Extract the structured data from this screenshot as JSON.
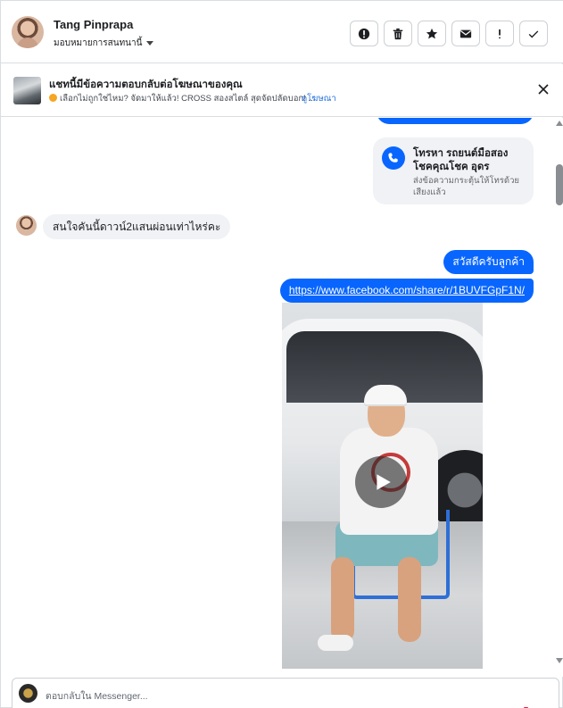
{
  "header": {
    "contact_name": "Tang Pinprapa",
    "assign_label": "มอบหมายการสนทนานี้",
    "actions": [
      {
        "name": "report-spam-button",
        "icon": "alert-circle-icon"
      },
      {
        "name": "delete-button",
        "icon": "trash-icon"
      },
      {
        "name": "star-button",
        "icon": "star-icon"
      },
      {
        "name": "mark-unread-button",
        "icon": "envelope-icon"
      },
      {
        "name": "follow-up-button",
        "icon": "exclamation-icon"
      },
      {
        "name": "mark-done-button",
        "icon": "checkmark-icon"
      }
    ]
  },
  "ad_banner": {
    "title": "แชทนี้มีข้อความตอบกลับต่อโฆษณาของคุณ",
    "subtitle": "เลือกไม่ถูกใช่ไหม? จัดมาให้แล้ว! CROSS สองสไตล์ สุดจัดปลัดบอก! ...",
    "view_ad_label": "ดูโฆษณา"
  },
  "messages": {
    "call_card": {
      "title": "โทรหา รถยนต์มือสอง โชคคุณโชค อุดร",
      "subtitle": "ส่งข้อความกระตุ้นให้โทรด้วยเสียงแล้ว"
    },
    "incoming_text": "สนใจคันนี้ดาวน์2แสนผ่อนเท่าไหร่คะ",
    "outgoing_greeting": "สวัสดีครับลูกค้า",
    "outgoing_link": "https://www.facebook.com/share/r/1BUVFGpF1N/"
  },
  "composer": {
    "placeholder": "ตอบกลับใน Messenger..."
  },
  "colors": {
    "messenger_blue": "#0866ff",
    "bubble_gray": "#f0f2f5",
    "link_blue": "#216fdb"
  }
}
